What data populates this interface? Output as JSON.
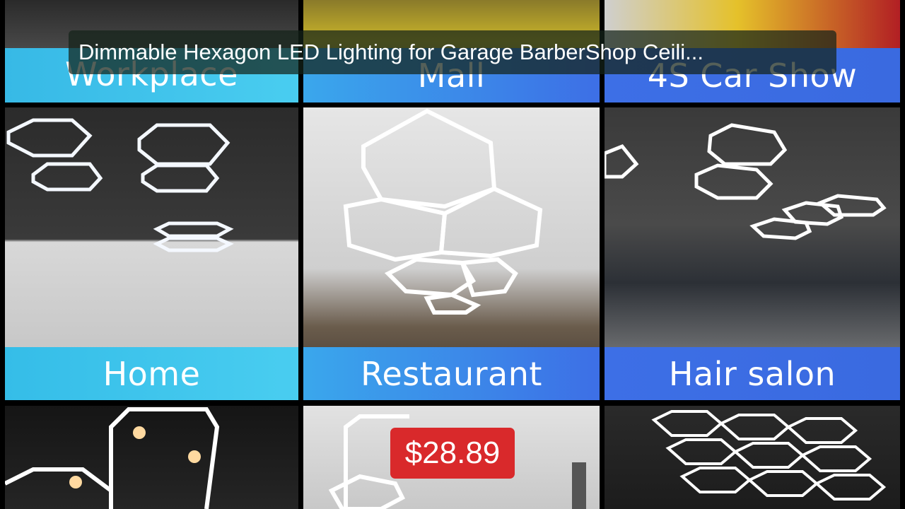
{
  "video": {
    "title": "Dimmable Hexagon LED Lighting for Garage BarberShop Ceili...",
    "price": "$28.89"
  },
  "collage": {
    "row1": [
      "Workplace",
      "Mall",
      "4S Car Show"
    ],
    "row2": [
      "Home",
      "Restaurant",
      "Hair salon"
    ]
  },
  "colors": {
    "banner_cyan": "#3fc2ea",
    "banner_blue": "#3d6fe6",
    "price_bg": "#d9292b"
  }
}
